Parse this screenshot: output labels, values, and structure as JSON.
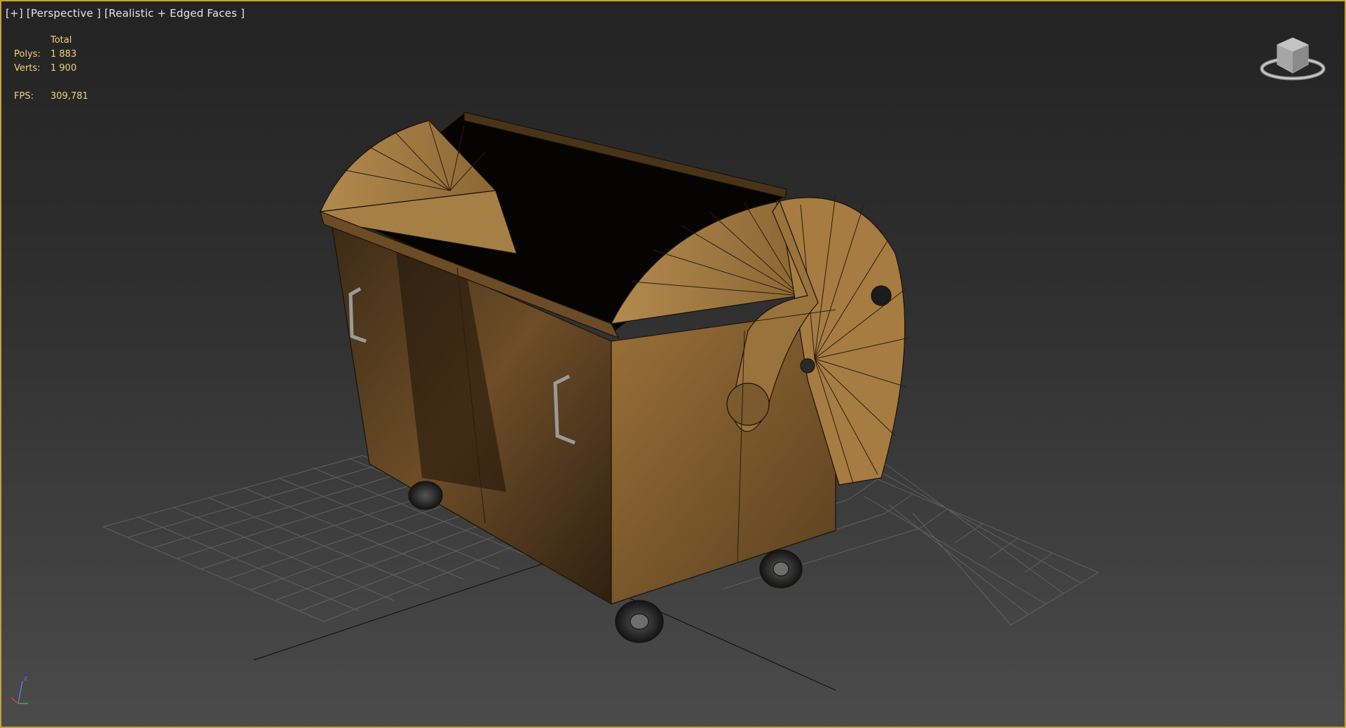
{
  "viewport": {
    "label_plus": "[+]",
    "label_view": "[Perspective ]",
    "label_shading": "[Realistic + Edged Faces ]",
    "border_color": "#c8a23a"
  },
  "stats": {
    "header": "Total",
    "polys_label": "Polys:",
    "polys_value": "1 883",
    "verts_label": "Verts:",
    "verts_value": "1 900",
    "fps_label": "FPS:",
    "fps_value": "309,781",
    "text_color": "#f1d27a"
  },
  "viewcube": {
    "icon": "viewcube-icon"
  },
  "axis_tripod": {
    "icon": "axis-tripod-icon",
    "z_label": "z"
  },
  "model": {
    "name": "dumpster-container",
    "color": "#8a6231"
  }
}
